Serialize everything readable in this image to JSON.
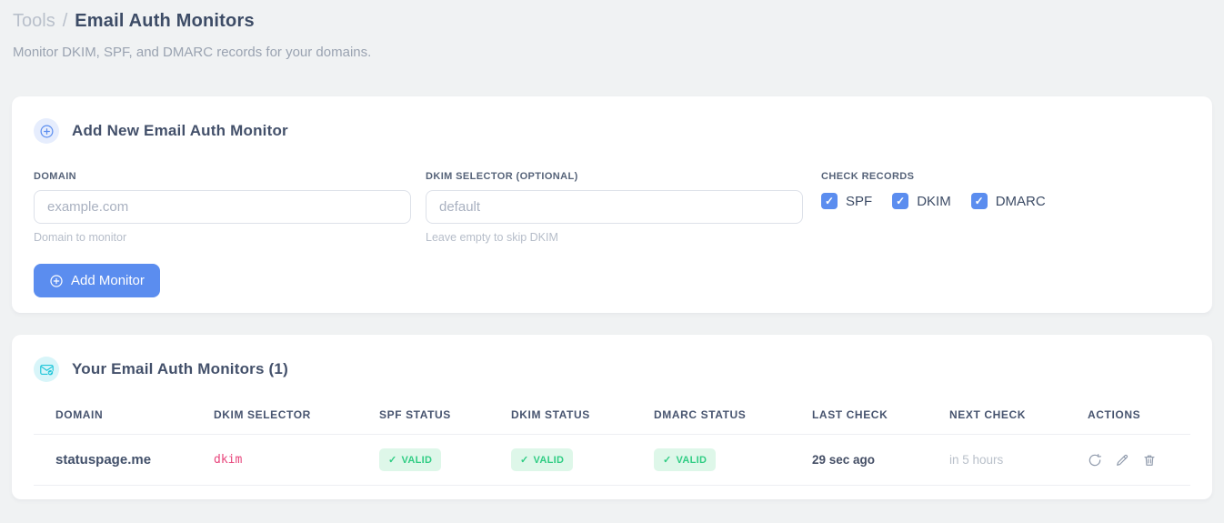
{
  "page": {
    "breadcrumb": "Tools",
    "breadcrumb_separator": "/",
    "title": "Email Auth Monitors",
    "subtitle": "Monitor DKIM, SPF, and DMARC records for your domains."
  },
  "icons": {
    "check": "✓"
  },
  "colors": {
    "accent_blue": "#5b8def",
    "valid_green": "#30cd84",
    "valid_bg": "#def7e9",
    "selector_pink": "#e8467c",
    "teal_icon": "#21c6d9",
    "page_bg": "#f0f2f3"
  },
  "add_monitor_card": {
    "title": "Add New Email Auth Monitor",
    "domain_field": {
      "label": "DOMAIN",
      "placeholder": "example.com",
      "value": "",
      "help": "Domain to monitor"
    },
    "dkim_field": {
      "label": "DKIM SELECTOR (OPTIONAL)",
      "placeholder": "default",
      "value": "",
      "help": "Leave empty to skip DKIM"
    },
    "check_records": {
      "label": "CHECK RECORDS",
      "options": [
        {
          "label": "SPF",
          "checked": true
        },
        {
          "label": "DKIM",
          "checked": true
        },
        {
          "label": "DMARC",
          "checked": true
        }
      ]
    },
    "submit_label": "Add Monitor"
  },
  "monitors_card": {
    "title": "Your Email Auth Monitors (1)",
    "table": {
      "headers": [
        "DOMAIN",
        "DKIM SELECTOR",
        "SPF STATUS",
        "DKIM STATUS",
        "DMARC STATUS",
        "LAST CHECK",
        "NEXT CHECK",
        "ACTIONS"
      ],
      "rows": [
        {
          "domain": "statuspage.me",
          "dkim_selector": "dkim",
          "spf_status": "VALID",
          "dkim_status": "VALID",
          "dmarc_status": "VALID",
          "last_check": "29 sec ago",
          "next_check": "in 5 hours"
        }
      ]
    }
  }
}
